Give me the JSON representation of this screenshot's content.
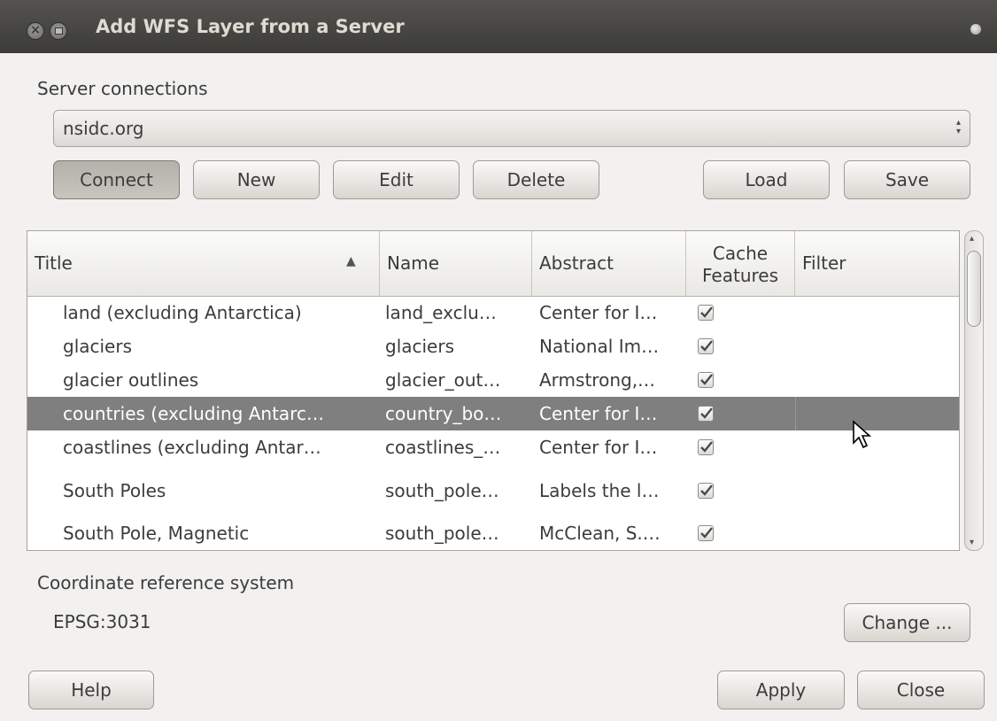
{
  "window": {
    "title": "Add WFS Layer from a Server"
  },
  "server": {
    "section_label": "Server connections",
    "selected": "nsidc.org",
    "buttons": {
      "connect": "Connect",
      "new": "New",
      "edit": "Edit",
      "delete": "Delete",
      "load": "Load",
      "save": "Save"
    }
  },
  "table": {
    "columns": {
      "title": "Title",
      "name": "Name",
      "abstract": "Abstract",
      "cache_line1": "Cache",
      "cache_line2": "Features",
      "filter": "Filter"
    },
    "rows": [
      {
        "title": "land (excluding Antarctica)",
        "name": "land_exclu…",
        "abstract": "Center for I…",
        "cache": true,
        "filter": ""
      },
      {
        "title": "glaciers",
        "name": "glaciers",
        "abstract": "National Im…",
        "cache": true,
        "filter": ""
      },
      {
        "title": "glacier outlines",
        "name": "glacier_out…",
        "abstract": "Armstrong,…",
        "cache": true,
        "filter": ""
      },
      {
        "title": "countries (excluding Antarc…",
        "name": "country_bo…",
        "abstract": "Center for I…",
        "cache": true,
        "filter": "",
        "selected": true
      },
      {
        "title": "coastlines (excluding Antar…",
        "name": "coastlines_…",
        "abstract": "Center for I…",
        "cache": true,
        "filter": ""
      },
      {
        "title": "South Poles",
        "name": "south_pole…",
        "abstract": "Labels the l…",
        "cache": true,
        "filter": ""
      },
      {
        "title": "South Pole, Magnetic",
        "name": "south_pole…",
        "abstract": "McClean, S.…",
        "cache": true,
        "filter": ""
      }
    ]
  },
  "crs": {
    "label": "Coordinate reference system",
    "value": "EPSG:3031",
    "change_label": "Change ..."
  },
  "footer": {
    "help": "Help",
    "apply": "Apply",
    "close": "Close"
  },
  "colors": {
    "titlebar": "#3c3b37",
    "window_bg": "#f2f1f0",
    "selection": "#7f7f7f"
  }
}
